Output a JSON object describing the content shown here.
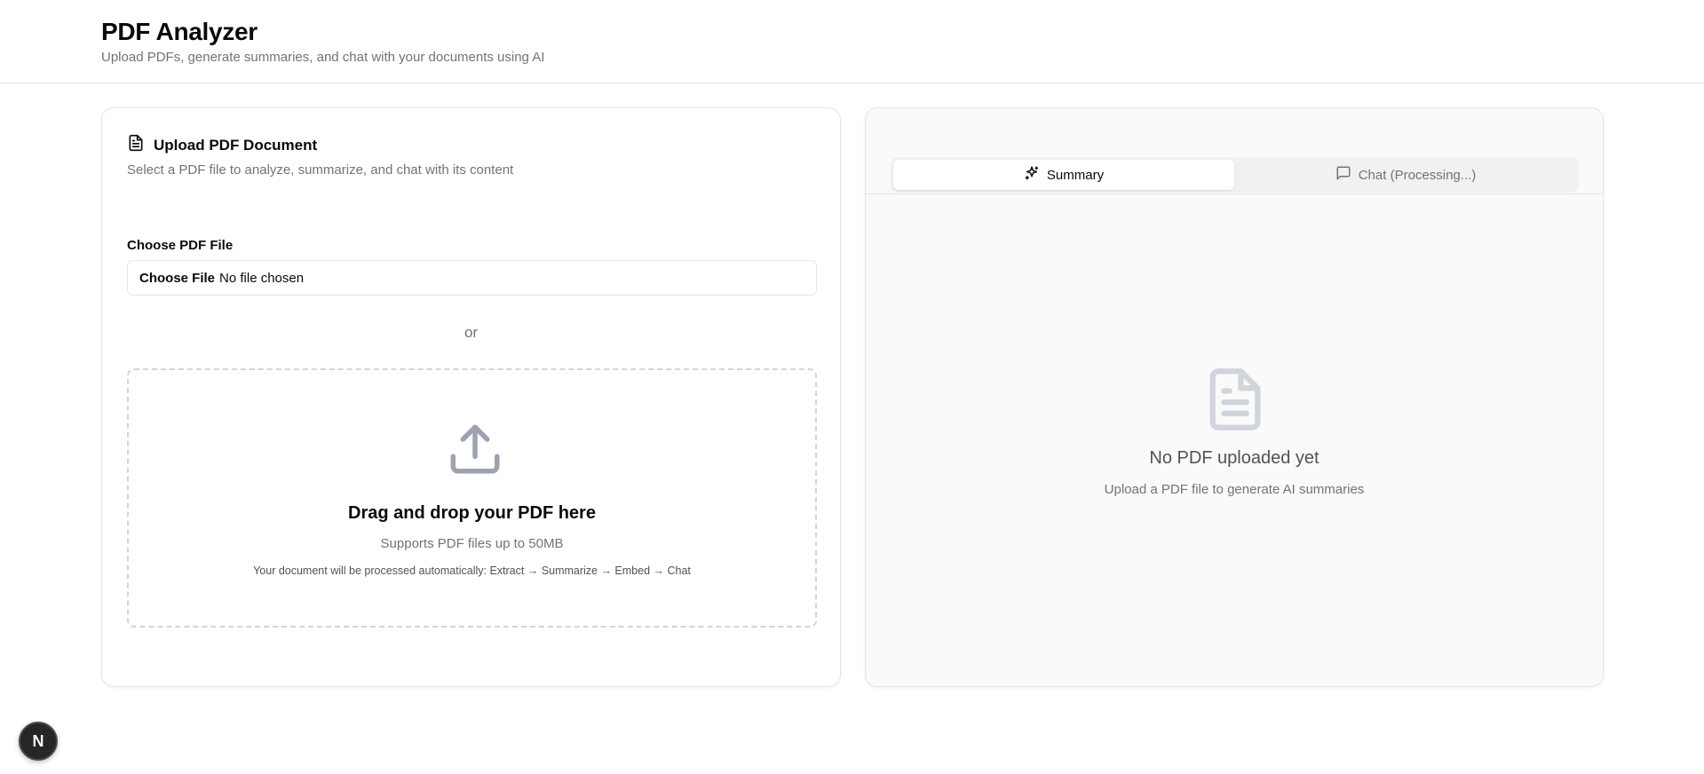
{
  "header": {
    "title": "PDF Analyzer",
    "subtitle": "Upload PDFs, generate summaries, and chat with your documents using AI"
  },
  "upload": {
    "icon": "file-text-icon",
    "title": "Upload PDF Document",
    "description": "Select a PDF file to analyze, summarize, and chat with its content",
    "field_label": "Choose PDF File",
    "file_button": "Choose File",
    "file_status": "No file chosen",
    "or_text": "or",
    "dropzone": {
      "icon": "upload-icon",
      "title": "Drag and drop your PDF here",
      "subtitle": "Supports PDF files up to 50MB",
      "note": "Your document will be processed automatically: Extract → Summarize → Embed → Chat"
    }
  },
  "tabs": [
    {
      "label": "Summary",
      "icon": "sparkles-icon",
      "active": true
    },
    {
      "label": "Chat (Processing...)",
      "icon": "message-square-icon",
      "active": false
    }
  ],
  "empty_state": {
    "icon": "file-text-icon",
    "title": "No PDF uploaded yet",
    "subtitle": "Upload a PDF file to generate AI summaries"
  },
  "dev_badge": {
    "label": "N"
  },
  "colors": {
    "text": "#0a0a0a",
    "muted": "#737373",
    "border": "#e5e5e5",
    "icon_gray": "#9ca3af"
  }
}
